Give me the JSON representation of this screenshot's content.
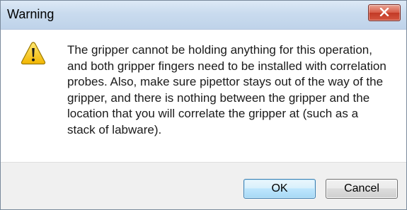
{
  "dialog": {
    "title": "Warning",
    "message": "The gripper cannot be holding anything for this operation, and both gripper fingers need to be installed with correlation probes. Also, make sure pipettor stays out of the way of the gripper, and there is nothing between the gripper and the location that you will correlate the gripper at (such as a stack of labware).",
    "icon": "warning-icon",
    "buttons": {
      "ok_label": "OK",
      "cancel_label": "Cancel"
    },
    "colors": {
      "close_button": "#d4553f",
      "titlebar": "#c9dbee",
      "footer": "#f0f0f0",
      "warning_fill": "#f5c400"
    }
  }
}
